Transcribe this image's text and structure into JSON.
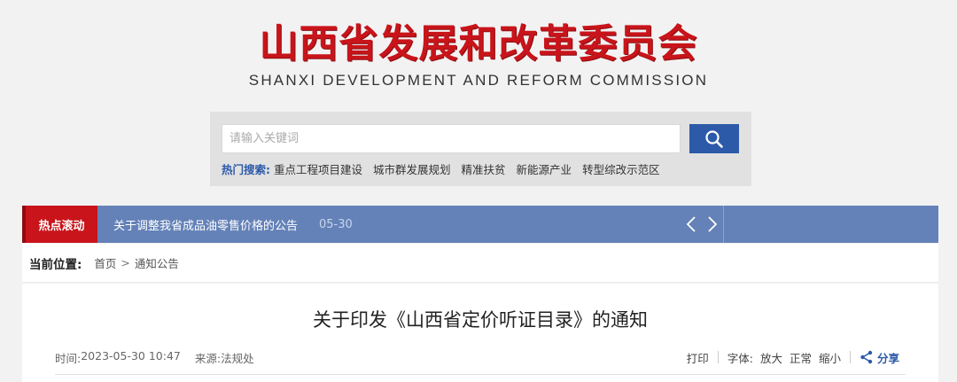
{
  "header": {
    "logo_cn": "山西省发展和改革委员会",
    "logo_en": "SHANXI DEVELOPMENT AND REFORM COMMISSION"
  },
  "search": {
    "placeholder": "请输入关键词",
    "button_icon": "search-icon",
    "hot_label": "热门搜索:",
    "hot_links": [
      "重点工程项目建设",
      "城市群发展规划",
      "精准扶贫",
      "新能源产业",
      "转型综改示范区"
    ]
  },
  "ticker": {
    "label": "热点滚动",
    "title": "关于调整我省成品油零售价格的公告",
    "date": "05-30",
    "prev_icon": "chevron-left-icon",
    "next_icon": "chevron-right-icon"
  },
  "breadcrumb": {
    "label": "当前位置:",
    "home": "首页",
    "separator": ">",
    "current": "通知公告"
  },
  "article": {
    "title": "关于印发《山西省定价听证目录》的通知",
    "time_label": "时间:",
    "time_value": "2023-05-30 10:47",
    "source_label": "来源:",
    "source_value": "法规处",
    "print": "打印",
    "font_label": "字体:",
    "font_large": "放大",
    "font_normal": "正常",
    "font_small": "缩小",
    "share": "分享",
    "share_icon": "share-icon"
  },
  "colors": {
    "brand_red": "#c8141a",
    "brand_blue": "#2d5aa8",
    "ticker_blue": "#6482b8"
  }
}
